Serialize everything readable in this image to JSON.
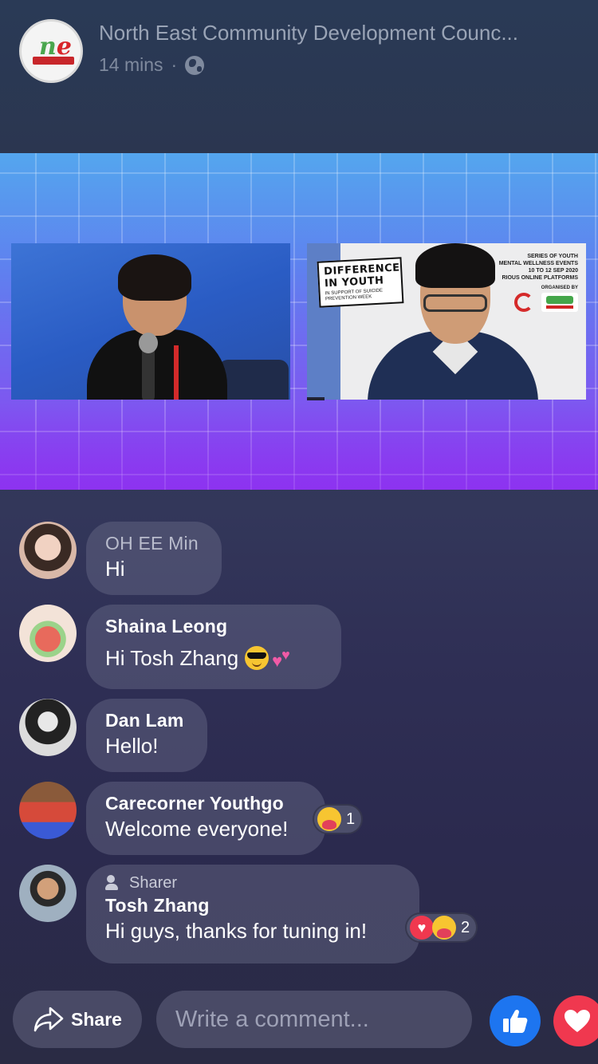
{
  "header": {
    "page_name": "North East Community Development Counc...",
    "time": "14 mins",
    "separator": "·",
    "privacy_icon": "globe-icon"
  },
  "video": {
    "poster_title": "DIFFERENCE IN YOUTH",
    "poster_subtitle": "IN SUPPORT OF SUICIDE PREVENTION WEEK",
    "poster_info_1": "SERIES OF YOUTH",
    "poster_info_2": "MENTAL WELLNESS EVENTS",
    "poster_info_3": "10 TO 12 SEP 2020",
    "poster_info_4": "RIOUS ONLINE PLATFORMS",
    "poster_organised": "ORGANISED BY"
  },
  "comments": [
    {
      "name": "OH EE Min",
      "text": "Hi"
    },
    {
      "name": "Shaina Leong",
      "text": "Hi Tosh Zhang"
    },
    {
      "name": "Dan Lam",
      "text": "Hello!"
    },
    {
      "name": "Carecorner Youthgo",
      "text": "Welcome everyone!",
      "reaction_count": "1"
    },
    {
      "badge": "Sharer",
      "name": "Tosh Zhang",
      "text": "Hi guys, thanks for tuning in!",
      "reaction_count": "2"
    }
  ],
  "bottom": {
    "share_label": "Share",
    "comment_placeholder": "Write a comment..."
  },
  "colors": {
    "like_blue": "#1d75f0",
    "love_red": "#f0384f"
  }
}
